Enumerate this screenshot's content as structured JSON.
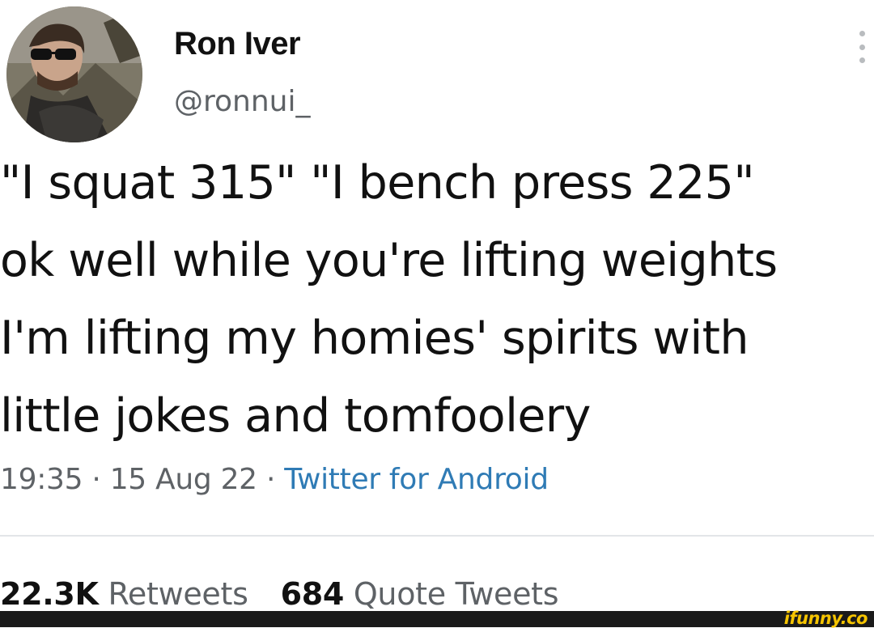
{
  "author": {
    "display_name": "Ron Iver",
    "handle": "@ronnui_"
  },
  "tweet": {
    "lines": [
      "\"I squat 315\" \"I bench press 225\"",
      "ok well while you're lifting weights",
      "I'm lifting my homies' spirits with",
      "little jokes and tomfoolery"
    ],
    "time": "19:35",
    "date": "15 Aug 22",
    "separator": " · ",
    "source": "Twitter for Android"
  },
  "stats": {
    "retweets_count": "22.3K",
    "retweets_label": "Retweets",
    "quotes_count": "684",
    "quotes_label": "Quote Tweets"
  },
  "watermark": "ifunny.co",
  "icons": {
    "more": "vertical-ellipsis-icon"
  },
  "colors": {
    "text": "#111111",
    "secondary_text": "#5e6266",
    "link": "#2f7bb5",
    "watermark": "#f5c400"
  }
}
